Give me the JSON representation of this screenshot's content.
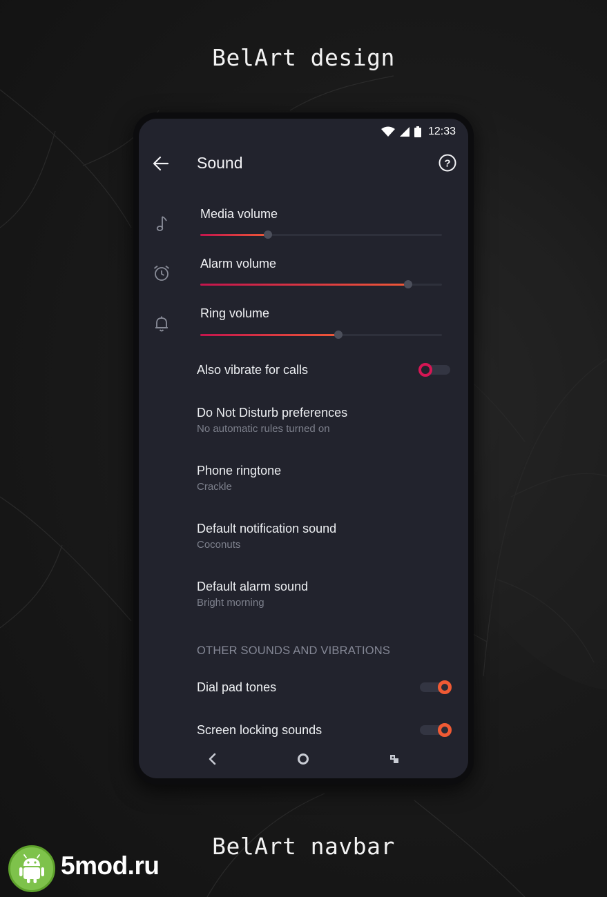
{
  "promo": {
    "top_caption": "BelArt design",
    "bottom_caption": "BelArt navbar"
  },
  "status_bar": {
    "time": "12:33",
    "icons": [
      "wifi-icon",
      "signal-icon",
      "battery-icon"
    ]
  },
  "app_bar": {
    "title": "Sound",
    "back_icon": "arrow-left-icon",
    "help_icon": "help-circle-icon"
  },
  "volumes": [
    {
      "label": "Media volume",
      "icon": "music-note-icon",
      "level": 0.28
    },
    {
      "label": "Alarm volume",
      "icon": "alarm-clock-icon",
      "level": 0.86
    },
    {
      "label": "Ring volume",
      "icon": "bell-icon",
      "level": 0.57
    }
  ],
  "settings": {
    "vibrate_calls": {
      "label": "Also vibrate for calls",
      "enabled": false
    },
    "dnd": {
      "label": "Do Not Disturb preferences",
      "summary": "No automatic rules turned on"
    },
    "ringtone": {
      "label": "Phone ringtone",
      "summary": "Crackle"
    },
    "notification_sound": {
      "label": "Default notification sound",
      "summary": "Coconuts"
    },
    "alarm_sound": {
      "label": "Default alarm sound",
      "summary": "Bright morning"
    }
  },
  "other_section": {
    "header": "OTHER SOUNDS AND VIBRATIONS",
    "dial_pad_tones": {
      "label": "Dial pad tones",
      "enabled": true
    },
    "screen_locking_sounds": {
      "label": "Screen locking sounds",
      "enabled": true
    }
  },
  "navbar": {
    "icons": [
      "back-chevron-icon",
      "home-circle-icon",
      "recents-icon"
    ]
  },
  "watermark": {
    "site": "5mod.ru",
    "icon": "android-icon"
  },
  "colors": {
    "background": "#22232d",
    "accent_start": "#c4154d",
    "accent_end": "#ee5838",
    "toggle_on": "#f05a34",
    "toggle_off": "#d61654"
  }
}
